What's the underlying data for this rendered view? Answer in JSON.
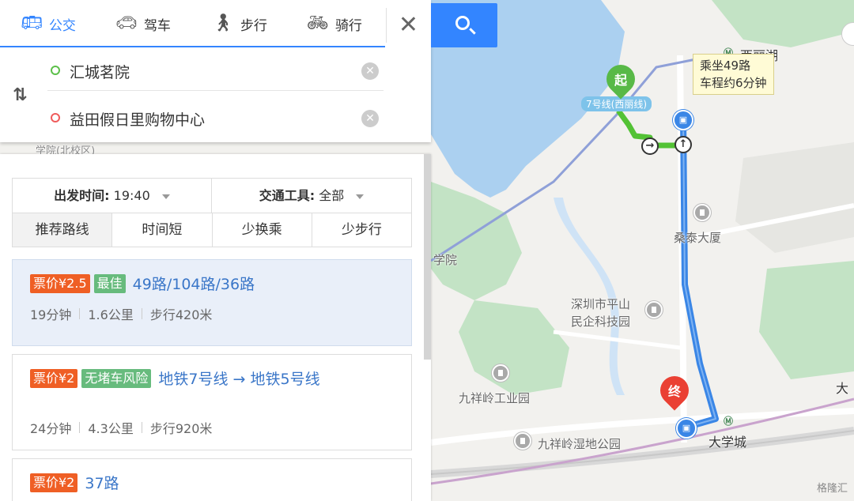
{
  "modes": [
    {
      "label": "公交",
      "icon": "bus-icon",
      "active": true
    },
    {
      "label": "驾车",
      "icon": "car-icon"
    },
    {
      "label": "步行",
      "icon": "walk-icon"
    },
    {
      "label": "骑行",
      "icon": "bike-icon"
    }
  ],
  "close_symbol": "✕",
  "search": {
    "from": "汇城茗院",
    "to": "益田假日里购物中心"
  },
  "filter": {
    "depart_label": "出发时间:",
    "depart_value": "19:40",
    "transport_label": "交通工具:",
    "transport_value": "全部",
    "sort_tabs": [
      "推荐路线",
      "时间短",
      "少换乘",
      "少步行"
    ]
  },
  "routes": [
    {
      "price": "票价¥2.5",
      "tag": "最佳",
      "name": "49路/104路/36路",
      "duration": "19分钟",
      "distance": "1.6公里",
      "walk": "步行420米"
    },
    {
      "price": "票价¥2",
      "tag": "无堵车风险",
      "name": "地铁7号线 → 地铁5号线",
      "duration": "24分钟",
      "distance": "4.3公里",
      "walk": "步行920米"
    },
    {
      "price": "票价¥2",
      "name": "37路"
    }
  ],
  "map": {
    "tip_line1": "乘坐49路",
    "tip_line2": "车程约6分钟",
    "line_tag": "7号线(西丽线)",
    "start_label": "起",
    "end_label": "终",
    "labels": {
      "xili_lake": "西丽湖",
      "sangtai": "桑泰大厦",
      "pingshan1": "深圳市平山",
      "pingshan2": "民企科技园",
      "jiuxiangling_ind": "九祥岭工业园",
      "jiuxiangling_park": "九祥岭湿地公园",
      "university_town": "大学城",
      "xueyuan": "学院",
      "beixiaoqu": "学院(北校区)",
      "da": "大",
      "watermark": "格隆汇"
    },
    "colors": {
      "transit_line": "#3a86e6",
      "walk_line": "#53c235",
      "metro7": "#8fa0d8",
      "metro5": "#c9a3cd",
      "water": "#abd0f0",
      "green": "#c3e3c5"
    }
  }
}
